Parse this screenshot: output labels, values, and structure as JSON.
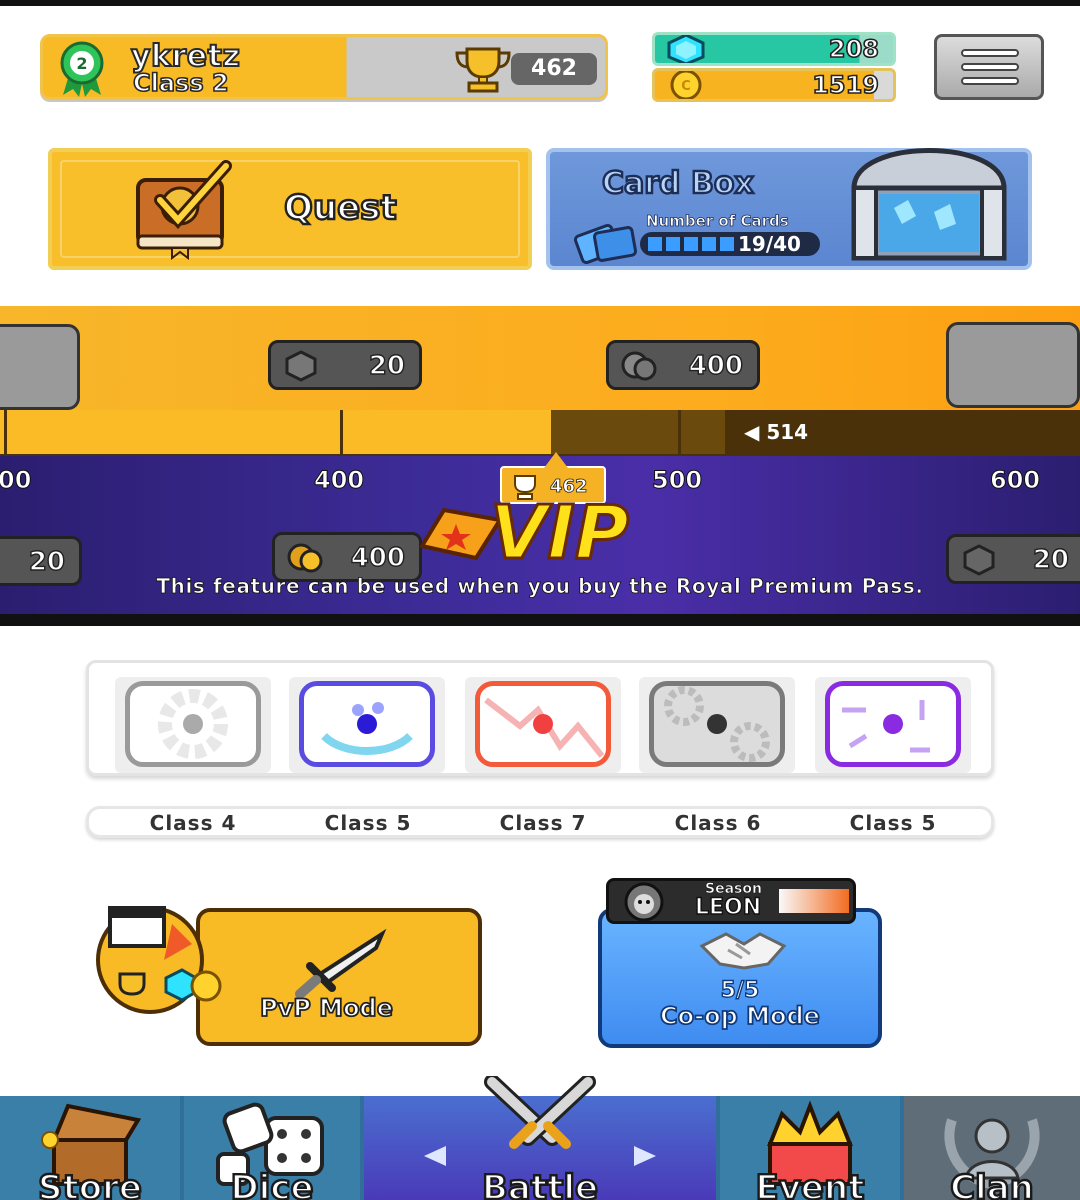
{
  "profile": {
    "name": "ykretz",
    "class_label": "Class 2",
    "rank_number": "2",
    "trophies": "462"
  },
  "currency": {
    "gems": "208",
    "coins": "1519",
    "coin_symbol": "C"
  },
  "quest": {
    "label": "Quest"
  },
  "card_box": {
    "title": "Card Box",
    "subtitle": "Number of Cards",
    "count": "19/40",
    "filled_segments": 5
  },
  "pass": {
    "rewards_top": [
      {
        "kind": "gem",
        "value": "20"
      },
      {
        "kind": "coin",
        "value": "400"
      }
    ],
    "current_progress": "514",
    "ticks": [
      "00",
      "400",
      "500",
      "600"
    ],
    "marker_value": "462",
    "vip_label": "VIP",
    "rewards_bottom": [
      {
        "kind": "gem",
        "value": "20"
      },
      {
        "kind": "coin",
        "value": "400"
      },
      {
        "kind": "gem",
        "value": "20"
      }
    ],
    "note": "This feature can be used when you buy the Royal Premium Pass."
  },
  "deck": [
    {
      "name": "gear-die",
      "class": "Class 4",
      "border": "#9a9a9a",
      "pip": "#aaaaaa"
    },
    {
      "name": "water-die",
      "class": "Class 5",
      "border": "#5a4ce0",
      "pip": "#2b1bd6"
    },
    {
      "name": "lightning-die",
      "class": "Class 7",
      "border": "#f25a3a",
      "pip": "#f04040"
    },
    {
      "name": "gears-die",
      "class": "Class 6",
      "border": "#7a7a7a",
      "pip": "#333333"
    },
    {
      "name": "wind-die",
      "class": "Class 5",
      "border": "#8a2be2",
      "pip": "#8a2be2"
    }
  ],
  "modes": {
    "pvp_label": "PvP Mode",
    "coop_count": "5/5",
    "coop_label": "Co-op Mode",
    "season_label": "Season",
    "season_boss": "LEON"
  },
  "nav": [
    "Store",
    "Dice",
    "Battle",
    "Event",
    "Clan"
  ],
  "colors": {
    "gold": "#f8bb25",
    "gem": "#27c7a3",
    "blue": "#3f8cf1",
    "nav": "#2f6f9a",
    "vip": "#ffe11a"
  }
}
